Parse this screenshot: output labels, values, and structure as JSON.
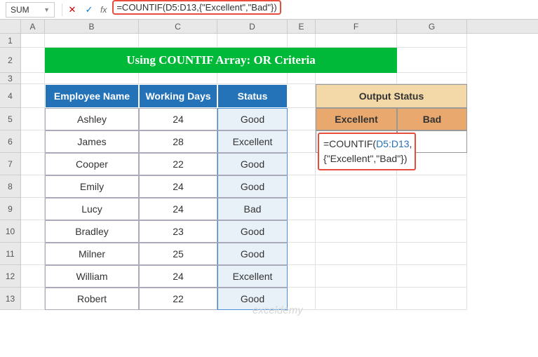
{
  "nameBox": "SUM",
  "formulaBar": "=COUNTIF(D5:D13,{\"Excellent\",\"Bad\"})",
  "columns": [
    "A",
    "B",
    "C",
    "D",
    "E",
    "F",
    "G"
  ],
  "rows": [
    "1",
    "2",
    "3",
    "4",
    "5",
    "6",
    "7",
    "8",
    "9",
    "10",
    "11",
    "12",
    "13"
  ],
  "title": "Using COUNTIF Array: OR Criteria",
  "headers": {
    "b": "Employee Name",
    "c": "Working Days",
    "d": "Status"
  },
  "output": {
    "title": "Output Status",
    "col1": "Excellent",
    "col2": "Bad"
  },
  "data": [
    {
      "name": "Ashley",
      "days": "24",
      "status": "Good"
    },
    {
      "name": "James",
      "days": "28",
      "status": "Excellent"
    },
    {
      "name": "Cooper",
      "days": "22",
      "status": "Good"
    },
    {
      "name": "Emily",
      "days": "24",
      "status": "Good"
    },
    {
      "name": "Lucy",
      "days": "24",
      "status": "Bad"
    },
    {
      "name": "Bradley",
      "days": "23",
      "status": "Good"
    },
    {
      "name": "Milner",
      "days": "25",
      "status": "Good"
    },
    {
      "name": "William",
      "days": "24",
      "status": "Excellent"
    },
    {
      "name": "Robert",
      "days": "22",
      "status": "Good"
    }
  ],
  "cellFormula": {
    "prefix": "=COUNTIF(",
    "ref": "D5:D13",
    "suffix": ",{\"Excellent\",\"Bad\"})"
  },
  "watermark": "exceldemy"
}
